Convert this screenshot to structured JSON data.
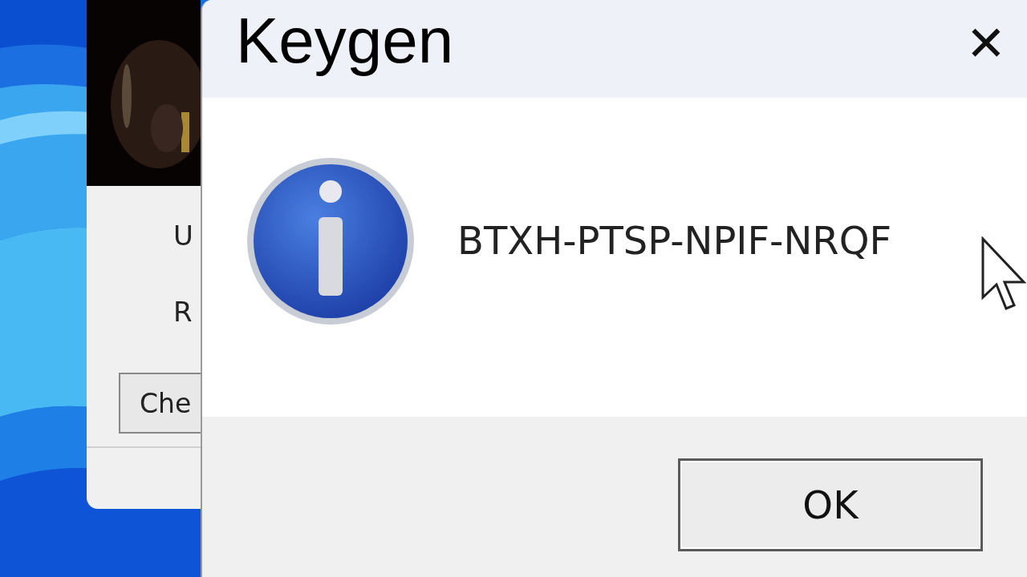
{
  "background_window": {
    "labels": [
      "U",
      "R"
    ],
    "button": "Che"
  },
  "dialog": {
    "title": "Keygen",
    "close": "✕",
    "message": "BTXH-PTSP-NPIF-NRQF",
    "buttons": [
      "OK"
    ]
  }
}
